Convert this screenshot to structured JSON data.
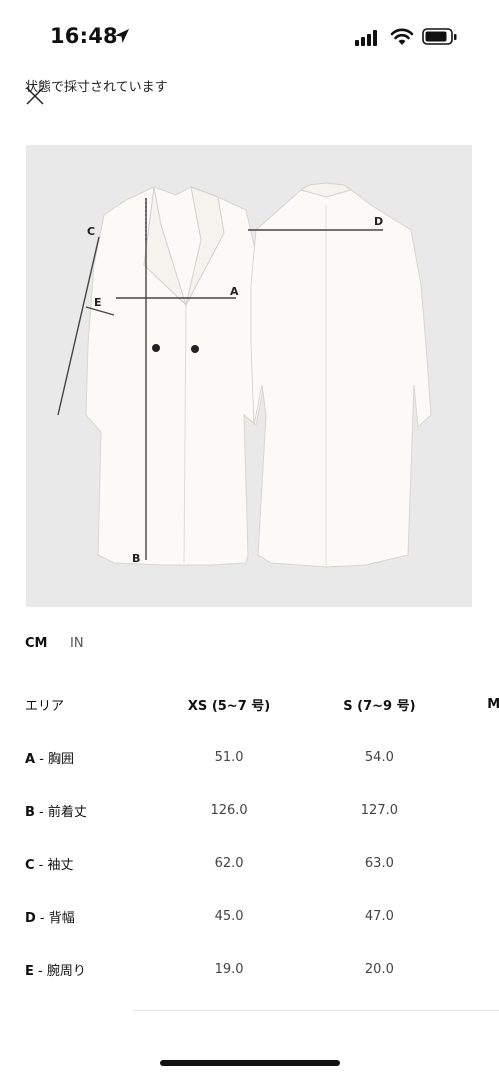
{
  "status": {
    "time": "16:48"
  },
  "header": {
    "caption": "状態で採寸されています"
  },
  "units": {
    "cm": "CM",
    "in": "IN"
  },
  "figure": {
    "markers": {
      "a": "A",
      "b": "B",
      "c": "C",
      "d": "D",
      "e": "E"
    }
  },
  "table": {
    "area_header": "エリア",
    "columns": [
      "XS (5~7 号)",
      "S (7~9 号)",
      "M"
    ],
    "rows": [
      {
        "key": "A",
        "name": " - 胸囲",
        "values": [
          "51.0",
          "54.0"
        ]
      },
      {
        "key": "B",
        "name": " - 前着丈",
        "values": [
          "126.0",
          "127.0"
        ]
      },
      {
        "key": "C",
        "name": " - 袖丈",
        "values": [
          "62.0",
          "63.0"
        ]
      },
      {
        "key": "D",
        "name": " - 背幅",
        "values": [
          "45.0",
          "47.0"
        ]
      },
      {
        "key": "E",
        "name": " - 腕周り",
        "values": [
          "19.0",
          "20.0"
        ]
      }
    ]
  }
}
